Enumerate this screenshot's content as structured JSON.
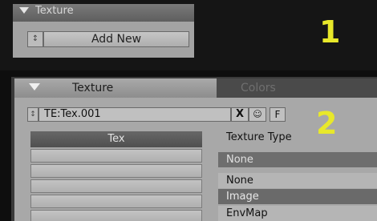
{
  "panel1": {
    "header_title": "Texture",
    "stepper_glyph": "↕",
    "add_button_label": "Add New",
    "callout_number": "1"
  },
  "panel2": {
    "tabs": [
      {
        "label": "Texture",
        "active": true
      },
      {
        "label": "Colors",
        "active": false
      }
    ],
    "texture_name": "TE:Tex.001",
    "unlink_glyph": "X",
    "users_glyph": "☺",
    "fake_user_label": "F",
    "callout_number": "2",
    "tex_list": {
      "header": "Tex",
      "slots": [
        "",
        "",
        "",
        "",
        ""
      ]
    },
    "texture_type": {
      "label": "Texture Type",
      "current_value": "None",
      "options": [
        "None",
        "Image",
        "EnvMap"
      ]
    }
  },
  "colors": {
    "callout": "#e8e82a",
    "panel_bg": "#a8a8a8",
    "highlight": "#6e6e6e"
  }
}
